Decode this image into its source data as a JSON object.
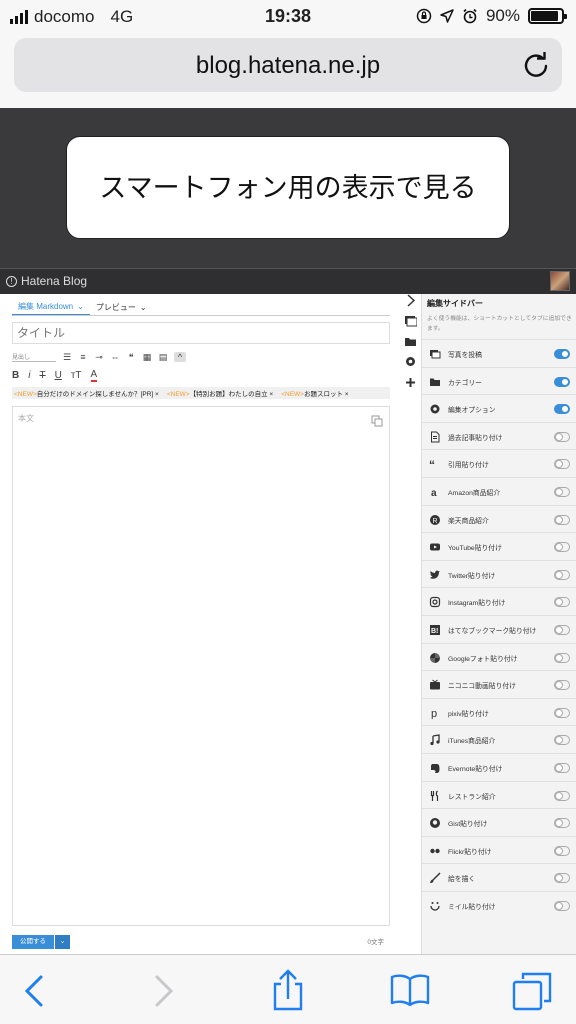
{
  "status": {
    "carrier": "docomo",
    "network": "4G",
    "time": "19:38",
    "battery_percent": "90%",
    "battery_level": 0.9
  },
  "browser": {
    "url": "blog.hatena.ne.jp"
  },
  "banner": {
    "smartphone_view": "スマートフォン用の表示で見る",
    "brand": "Hatena Blog"
  },
  "editor": {
    "tab_edit": "編集 Markdown",
    "tab_preview": "プレビュー",
    "title_placeholder": "タイトル",
    "heading_select": "見出し",
    "news": [
      {
        "tag": "<NEW>",
        "text": "自分だけのドメイン探しませんか？[PR] ×"
      },
      {
        "tag": "<NEW>",
        "text": "【特別お題】わたしの自立 ×"
      },
      {
        "tag": "<NEW>",
        "text": "お題スロット ×"
      }
    ],
    "body_placeholder": "本文",
    "publish": "公開する",
    "char_count": "0文字"
  },
  "sidebar": {
    "title": "編集サイドバー",
    "description": "よく使う機能は、ショートカットとしてタブに追加できます。",
    "items": [
      {
        "label": "写真を投稿",
        "icon": "photo-icon",
        "on": true
      },
      {
        "label": "カテゴリー",
        "icon": "folder-icon",
        "on": true
      },
      {
        "label": "編集オプション",
        "icon": "gear-icon",
        "on": true
      },
      {
        "label": "過去記事貼り付け",
        "icon": "document-icon",
        "on": false
      },
      {
        "label": "引用貼り付け",
        "icon": "quote-icon",
        "on": false
      },
      {
        "label": "Amazon商品紹介",
        "icon": "amazon-icon",
        "on": false
      },
      {
        "label": "楽天商品紹介",
        "icon": "rakuten-icon",
        "on": false
      },
      {
        "label": "YouTube貼り付け",
        "icon": "youtube-icon",
        "on": false
      },
      {
        "label": "Twitter貼り付け",
        "icon": "twitter-icon",
        "on": false
      },
      {
        "label": "Instagram貼り付け",
        "icon": "instagram-icon",
        "on": false
      },
      {
        "label": "はてなブックマーク貼り付け",
        "icon": "hatena-bookmark-icon",
        "on": false
      },
      {
        "label": "Googleフォト貼り付け",
        "icon": "google-photos-icon",
        "on": false
      },
      {
        "label": "ニコニコ動画貼り付け",
        "icon": "niconico-icon",
        "on": false
      },
      {
        "label": "pixiv貼り付け",
        "icon": "pixiv-icon",
        "on": false
      },
      {
        "label": "iTunes商品紹介",
        "icon": "music-note-icon",
        "on": false
      },
      {
        "label": "Evernote貼り付け",
        "icon": "evernote-icon",
        "on": false
      },
      {
        "label": "レストラン紹介",
        "icon": "restaurant-icon",
        "on": false
      },
      {
        "label": "Gist貼り付け",
        "icon": "github-icon",
        "on": false
      },
      {
        "label": "Flickr貼り付け",
        "icon": "flickr-icon",
        "on": false
      },
      {
        "label": "絵を描く",
        "icon": "brush-icon",
        "on": false
      },
      {
        "label": "ミイル貼り付け",
        "icon": "miil-icon",
        "on": false
      }
    ]
  },
  "colors": {
    "accent": "#3a8ed8",
    "new_tag": "#f19d34",
    "banner": "#3a3a3c"
  }
}
